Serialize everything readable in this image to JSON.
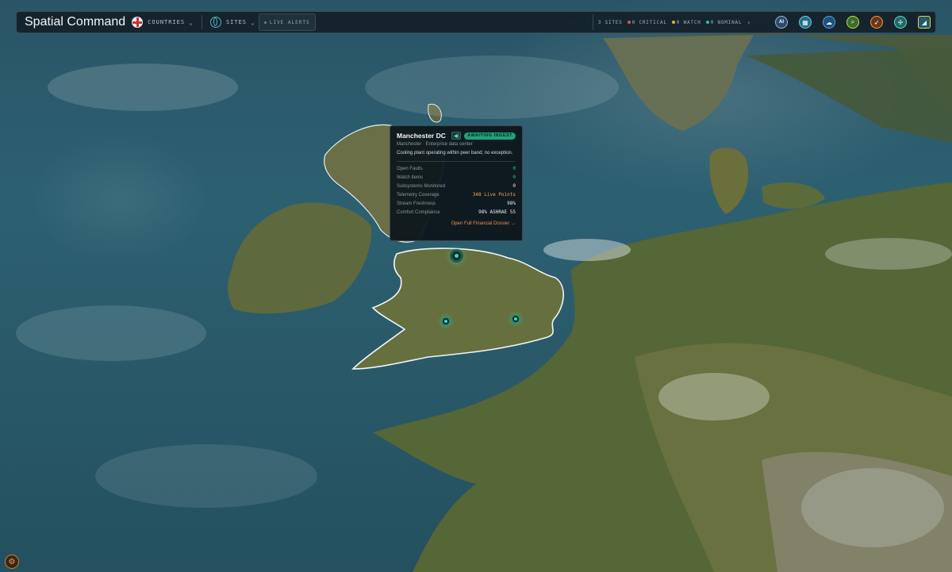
{
  "app": {
    "title": "Spatial Command"
  },
  "topbar": {
    "countries_label": "COUNTRIES",
    "sites_label": "SITES",
    "live_alerts_label": "LIVE ALERTS",
    "site_count": "3 SITES",
    "critical": "0 CRITICAL",
    "watch": "0 WATCH",
    "nominal": "0 NOMINAL",
    "ai_label": "AI"
  },
  "colors": {
    "critical": "#e0505a",
    "watch": "#e0b040",
    "nominal": "#2fc19a",
    "accent": "#1fa37a",
    "link": "#f28a4a"
  },
  "icons": [
    "flag-england-icon",
    "globe-icon",
    "ai-icon",
    "solar-icon",
    "cloud-icon",
    "search-icon",
    "compass-icon",
    "wind-icon",
    "chart-icon",
    "gear-icon"
  ],
  "popup": {
    "title": "Manchester DC",
    "badge": "AWAITING INGEST",
    "subtitle": "Manchester · Enterprise data center",
    "description": "Cooling plant operating within peer band; no exception.",
    "rows": [
      {
        "label": "Open Faults",
        "value": "0"
      },
      {
        "label": "Watch Items",
        "value": "0"
      },
      {
        "label": "Subsystems Monitored",
        "value": "0"
      },
      {
        "label": "Telemetry Coverage",
        "value": "348 Live Points"
      },
      {
        "label": "Stream Freshness",
        "value": "98%"
      },
      {
        "label": "Comfort Compliance",
        "value": "98% ASHRAE 55"
      }
    ],
    "link": "Open Full Financial Dossier →"
  }
}
